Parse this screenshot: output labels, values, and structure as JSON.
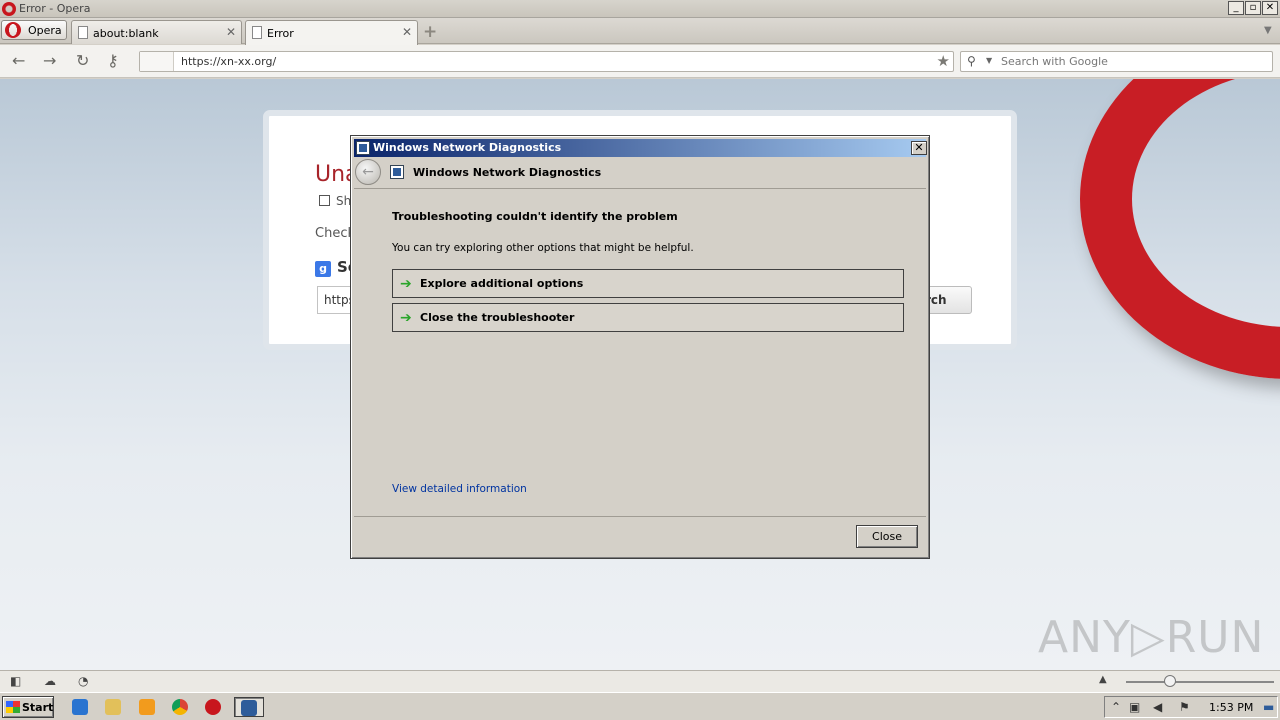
{
  "window": {
    "title": "Error - Opera",
    "min": "_",
    "max": "▫",
    "close": "✕"
  },
  "tabs": {
    "menu_label": "Opera",
    "items": [
      {
        "label": "about:blank",
        "close": "✕"
      },
      {
        "label": "Error",
        "close": "✕"
      }
    ],
    "new_tab": "+"
  },
  "toolbar": {
    "back": "←",
    "forward": "→",
    "reload": "↻",
    "key": "⚷",
    "url": "https://xn-xx.org/",
    "bookmark": "★",
    "search_placeholder": "Search with Google"
  },
  "error_page": {
    "heading": "Una",
    "checkbox_label": "Sh",
    "check_text": "Check",
    "search_heading": "Se",
    "search_value": "https",
    "search_button": "rch"
  },
  "dialog": {
    "title": "Windows Network Diagnostics",
    "header_title": "Windows Network Diagnostics",
    "main_message": "Troubleshooting couldn't identify the problem",
    "sub_message": "You can try exploring other options that might be helpful.",
    "options": [
      {
        "label": "Explore additional options"
      },
      {
        "label": "Close the troubleshooter"
      }
    ],
    "link": "View detailed information",
    "close_button": "Close",
    "close_x": "✕"
  },
  "statusbar": {
    "zoom_value": 0.3
  },
  "taskbar": {
    "start": "Start",
    "clock": "1:53 PM"
  },
  "watermark": "ANY▷RUN",
  "colors": {
    "opera_red": "#c81e25",
    "dialog_title": "#0a246a",
    "link": "#0033a0",
    "arrow_green": "#2aa52a"
  }
}
